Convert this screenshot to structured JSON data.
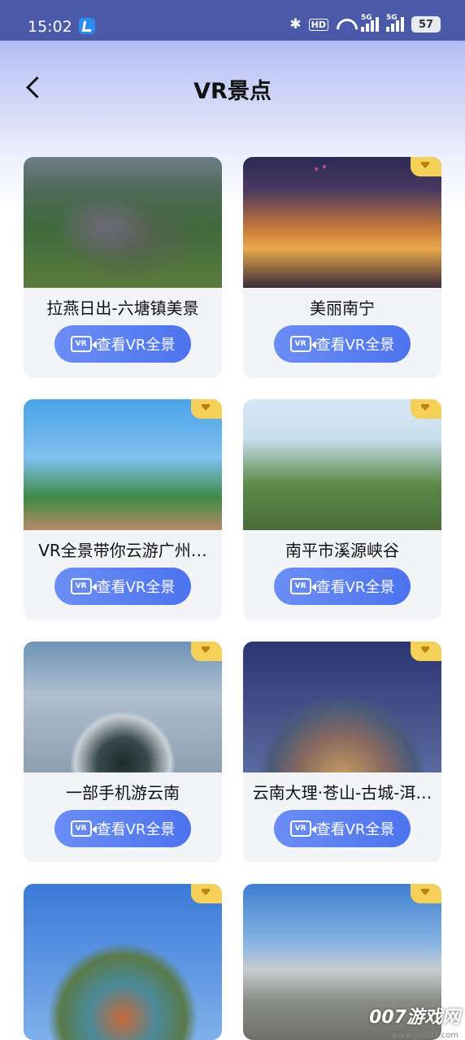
{
  "status_bar": {
    "time": "15:02",
    "hd_label": "HD",
    "signal1_label": "5G",
    "signal2_label": "5G",
    "battery": "57"
  },
  "header": {
    "title": "VR景点"
  },
  "cards": [
    {
      "title": "拉燕日出-六塘镇美景",
      "button_label": "查看VR全景",
      "premium": false
    },
    {
      "title": "美丽南宁",
      "button_label": "查看VR全景",
      "premium": true
    },
    {
      "title": "VR全景带你云游广州…",
      "button_label": "查看VR全景",
      "premium": true
    },
    {
      "title": "南平市溪源峡谷",
      "button_label": "查看VR全景",
      "premium": true
    },
    {
      "title": "一部手机游云南",
      "button_label": "查看VR全景",
      "premium": true
    },
    {
      "title": "云南大理·苍山-古城-洱…",
      "button_label": "查看VR全景",
      "premium": true
    },
    {
      "title": "",
      "button_label": "",
      "premium": true
    },
    {
      "title": "",
      "button_label": "",
      "premium": true
    }
  ],
  "vr_icon_text": "VR",
  "watermark": {
    "text": "007游戏网",
    "url": "www.yx007.com"
  }
}
